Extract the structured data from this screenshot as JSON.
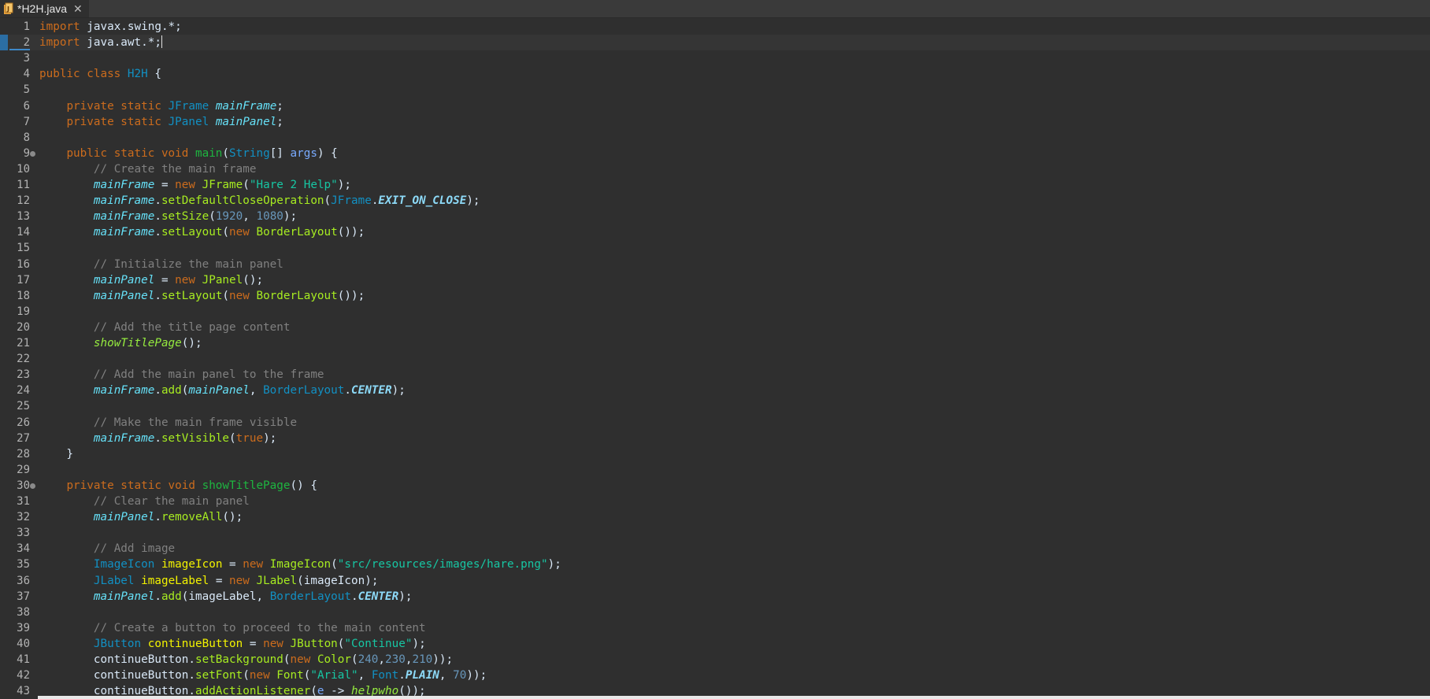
{
  "tab": {
    "title": "*H2H.java",
    "icon": "java-file-icon",
    "close_icon": "close-icon"
  },
  "editor": {
    "lines": [
      {
        "num": "1",
        "tokens": [
          [
            "kw",
            "import"
          ],
          [
            "t",
            " javax.swing.*;"
          ]
        ]
      },
      {
        "num": "2",
        "tokens": [
          [
            "kw",
            "import"
          ],
          [
            "t",
            " java.awt.*;"
          ]
        ]
      },
      {
        "num": "3",
        "tokens": []
      },
      {
        "num": "4",
        "tokens": [
          [
            "kw",
            "public class "
          ],
          [
            "typ",
            "H2H"
          ],
          [
            "t",
            " {"
          ]
        ]
      },
      {
        "num": "5",
        "tokens": []
      },
      {
        "num": "6",
        "tokens": [
          [
            "t",
            "    "
          ],
          [
            "kw",
            "private static "
          ],
          [
            "typ",
            "JFrame"
          ],
          [
            "t",
            " "
          ],
          [
            "fld",
            "mainFrame"
          ],
          [
            "t",
            ";"
          ]
        ]
      },
      {
        "num": "7",
        "tokens": [
          [
            "t",
            "    "
          ],
          [
            "kw",
            "private static "
          ],
          [
            "typ",
            "JPanel"
          ],
          [
            "t",
            " "
          ],
          [
            "fld",
            "mainPanel"
          ],
          [
            "t",
            ";"
          ]
        ]
      },
      {
        "num": "8",
        "tokens": []
      },
      {
        "num": "9",
        "tokens": [
          [
            "t",
            "    "
          ],
          [
            "kw",
            "public static void "
          ],
          [
            "mdecl",
            "main"
          ],
          [
            "t",
            "("
          ],
          [
            "typ",
            "String"
          ],
          [
            "t",
            "[] "
          ],
          [
            "param",
            "args"
          ],
          [
            "t",
            ") {"
          ]
        ]
      },
      {
        "num": "10",
        "tokens": [
          [
            "t",
            "        "
          ],
          [
            "cmt",
            "// Create the main frame"
          ]
        ]
      },
      {
        "num": "11",
        "tokens": [
          [
            "t",
            "        "
          ],
          [
            "fld",
            "mainFrame"
          ],
          [
            "t",
            " = "
          ],
          [
            "kw",
            "new "
          ],
          [
            "call",
            "JFrame"
          ],
          [
            "t",
            "("
          ],
          [
            "str",
            "\"Hare 2 Help\""
          ],
          [
            "t",
            ");"
          ]
        ]
      },
      {
        "num": "12",
        "tokens": [
          [
            "t",
            "        "
          ],
          [
            "fld",
            "mainFrame"
          ],
          [
            "t",
            "."
          ],
          [
            "call",
            "setDefaultCloseOperation"
          ],
          [
            "t",
            "("
          ],
          [
            "typ",
            "JFrame"
          ],
          [
            "t",
            "."
          ],
          [
            "const",
            "EXIT_ON_CLOSE"
          ],
          [
            "t",
            ");"
          ]
        ]
      },
      {
        "num": "13",
        "tokens": [
          [
            "t",
            "        "
          ],
          [
            "fld",
            "mainFrame"
          ],
          [
            "t",
            "."
          ],
          [
            "call",
            "setSize"
          ],
          [
            "t",
            "("
          ],
          [
            "num",
            "1920"
          ],
          [
            "t",
            ", "
          ],
          [
            "num",
            "1080"
          ],
          [
            "t",
            ");"
          ]
        ]
      },
      {
        "num": "14",
        "tokens": [
          [
            "t",
            "        "
          ],
          [
            "fld",
            "mainFrame"
          ],
          [
            "t",
            "."
          ],
          [
            "call",
            "setLayout"
          ],
          [
            "t",
            "("
          ],
          [
            "kw",
            "new "
          ],
          [
            "call",
            "BorderLayout"
          ],
          [
            "t",
            "());"
          ]
        ]
      },
      {
        "num": "15",
        "tokens": []
      },
      {
        "num": "16",
        "tokens": [
          [
            "t",
            "        "
          ],
          [
            "cmt",
            "// Initialize the main panel"
          ]
        ]
      },
      {
        "num": "17",
        "tokens": [
          [
            "t",
            "        "
          ],
          [
            "fld",
            "mainPanel"
          ],
          [
            "t",
            " = "
          ],
          [
            "kw",
            "new "
          ],
          [
            "call",
            "JPanel"
          ],
          [
            "t",
            "();"
          ]
        ]
      },
      {
        "num": "18",
        "tokens": [
          [
            "t",
            "        "
          ],
          [
            "fld",
            "mainPanel"
          ],
          [
            "t",
            "."
          ],
          [
            "call",
            "setLayout"
          ],
          [
            "t",
            "("
          ],
          [
            "kw",
            "new "
          ],
          [
            "call",
            "BorderLayout"
          ],
          [
            "t",
            "());"
          ]
        ]
      },
      {
        "num": "19",
        "tokens": []
      },
      {
        "num": "20",
        "tokens": [
          [
            "t",
            "        "
          ],
          [
            "cmt",
            "// Add the title page content"
          ]
        ]
      },
      {
        "num": "21",
        "tokens": [
          [
            "t",
            "        "
          ],
          [
            "scall",
            "showTitlePage"
          ],
          [
            "t",
            "();"
          ]
        ]
      },
      {
        "num": "22",
        "tokens": []
      },
      {
        "num": "23",
        "tokens": [
          [
            "t",
            "        "
          ],
          [
            "cmt",
            "// Add the main panel to the frame"
          ]
        ]
      },
      {
        "num": "24",
        "tokens": [
          [
            "t",
            "        "
          ],
          [
            "fld",
            "mainFrame"
          ],
          [
            "t",
            "."
          ],
          [
            "call",
            "add"
          ],
          [
            "t",
            "("
          ],
          [
            "fld",
            "mainPanel"
          ],
          [
            "t",
            ", "
          ],
          [
            "typ",
            "BorderLayout"
          ],
          [
            "t",
            "."
          ],
          [
            "const",
            "CENTER"
          ],
          [
            "t",
            ");"
          ]
        ]
      },
      {
        "num": "25",
        "tokens": []
      },
      {
        "num": "26",
        "tokens": [
          [
            "t",
            "        "
          ],
          [
            "cmt",
            "// Make the main frame visible"
          ]
        ]
      },
      {
        "num": "27",
        "tokens": [
          [
            "t",
            "        "
          ],
          [
            "fld",
            "mainFrame"
          ],
          [
            "t",
            "."
          ],
          [
            "call",
            "setVisible"
          ],
          [
            "t",
            "("
          ],
          [
            "kw",
            "true"
          ],
          [
            "t",
            ");"
          ]
        ]
      },
      {
        "num": "28",
        "tokens": [
          [
            "t",
            "    }"
          ]
        ]
      },
      {
        "num": "29",
        "tokens": []
      },
      {
        "num": "30",
        "tokens": [
          [
            "t",
            "    "
          ],
          [
            "kw",
            "private static void "
          ],
          [
            "mdecl",
            "showTitlePage"
          ],
          [
            "t",
            "() {"
          ]
        ]
      },
      {
        "num": "31",
        "tokens": [
          [
            "t",
            "        "
          ],
          [
            "cmt",
            "// Clear the main panel"
          ]
        ]
      },
      {
        "num": "32",
        "tokens": [
          [
            "t",
            "        "
          ],
          [
            "fld",
            "mainPanel"
          ],
          [
            "t",
            "."
          ],
          [
            "call",
            "removeAll"
          ],
          [
            "t",
            "();"
          ]
        ]
      },
      {
        "num": "33",
        "tokens": []
      },
      {
        "num": "34",
        "tokens": [
          [
            "t",
            "        "
          ],
          [
            "cmt",
            "// Add image"
          ]
        ]
      },
      {
        "num": "35",
        "tokens": [
          [
            "t",
            "        "
          ],
          [
            "typ",
            "ImageIcon"
          ],
          [
            "t",
            " "
          ],
          [
            "var",
            "imageIcon"
          ],
          [
            "t",
            " = "
          ],
          [
            "kw",
            "new "
          ],
          [
            "call",
            "ImageIcon"
          ],
          [
            "t",
            "("
          ],
          [
            "str",
            "\"src/resources/images/hare.png\""
          ],
          [
            "t",
            ");"
          ]
        ]
      },
      {
        "num": "36",
        "tokens": [
          [
            "t",
            "        "
          ],
          [
            "typ",
            "JLabel"
          ],
          [
            "t",
            " "
          ],
          [
            "var",
            "imageLabel"
          ],
          [
            "t",
            " = "
          ],
          [
            "kw",
            "new "
          ],
          [
            "call",
            "JLabel"
          ],
          [
            "t",
            "(imageIcon);"
          ]
        ]
      },
      {
        "num": "37",
        "tokens": [
          [
            "t",
            "        "
          ],
          [
            "fld",
            "mainPanel"
          ],
          [
            "t",
            "."
          ],
          [
            "call",
            "add"
          ],
          [
            "t",
            "(imageLabel, "
          ],
          [
            "typ",
            "BorderLayout"
          ],
          [
            "t",
            "."
          ],
          [
            "const",
            "CENTER"
          ],
          [
            "t",
            ");"
          ]
        ]
      },
      {
        "num": "38",
        "tokens": []
      },
      {
        "num": "39",
        "tokens": [
          [
            "t",
            "        "
          ],
          [
            "cmt",
            "// Create a button to proceed to the main content"
          ]
        ]
      },
      {
        "num": "40",
        "tokens": [
          [
            "t",
            "        "
          ],
          [
            "typ",
            "JButton"
          ],
          [
            "t",
            " "
          ],
          [
            "var",
            "continueButton"
          ],
          [
            "t",
            " = "
          ],
          [
            "kw",
            "new "
          ],
          [
            "call",
            "JButton"
          ],
          [
            "t",
            "("
          ],
          [
            "str",
            "\"Continue\""
          ],
          [
            "t",
            ");"
          ]
        ]
      },
      {
        "num": "41",
        "tokens": [
          [
            "t",
            "        continueButton."
          ],
          [
            "call",
            "setBackground"
          ],
          [
            "t",
            "("
          ],
          [
            "kw",
            "new "
          ],
          [
            "call",
            "Color"
          ],
          [
            "t",
            "("
          ],
          [
            "num",
            "240"
          ],
          [
            "t",
            ","
          ],
          [
            "num",
            "230"
          ],
          [
            "t",
            ","
          ],
          [
            "num",
            "210"
          ],
          [
            "t",
            "));"
          ]
        ]
      },
      {
        "num": "42",
        "tokens": [
          [
            "t",
            "        continueButton."
          ],
          [
            "call",
            "setFont"
          ],
          [
            "t",
            "("
          ],
          [
            "kw",
            "new "
          ],
          [
            "call",
            "Font"
          ],
          [
            "t",
            "("
          ],
          [
            "str",
            "\"Arial\""
          ],
          [
            "t",
            ", "
          ],
          [
            "typ",
            "Font"
          ],
          [
            "t",
            "."
          ],
          [
            "const",
            "PLAIN"
          ],
          [
            "t",
            ", "
          ],
          [
            "num",
            "70"
          ],
          [
            "t",
            "));"
          ]
        ]
      },
      {
        "num": "43",
        "tokens": [
          [
            "t",
            "        continueButton."
          ],
          [
            "call",
            "addActionListener"
          ],
          [
            "t",
            "("
          ],
          [
            "param",
            "e"
          ],
          [
            "t",
            " -> "
          ],
          [
            "scall",
            "helpwho"
          ],
          [
            "t",
            "());"
          ]
        ]
      }
    ],
    "fold_lines": [
      "9",
      "30"
    ],
    "current_line": "2"
  },
  "colors": {
    "background": "#2f2f2f",
    "kw": "#cc6c1d",
    "t": "#d9e8f7",
    "typ": "#1290c3",
    "fld": "#66e1f8",
    "mdecl": "#1eb540",
    "call": "#a7ec21",
    "scall": "#96ec3f",
    "str": "#17c6a3",
    "num": "#6897bb",
    "cmt": "#808080",
    "const": "#8ddaf8",
    "param": "#79abff",
    "var": "#f2f200"
  }
}
